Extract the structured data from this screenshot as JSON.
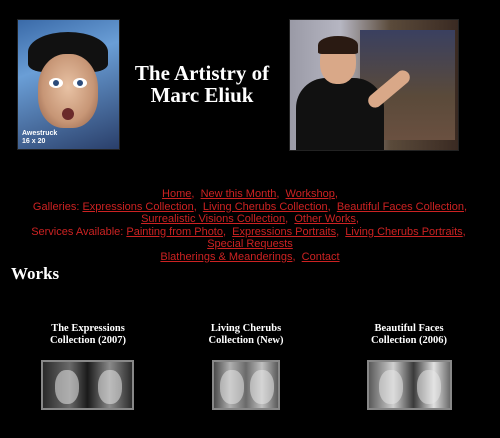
{
  "header": {
    "left_image_caption_line1": "Awestruck",
    "left_image_caption_line2": "16 x 20",
    "title_line1": "The Artistry of",
    "title_line2": "Marc Eliuk"
  },
  "nav": {
    "line1": [
      "Home",
      "New this Month",
      "Workshop"
    ],
    "galleries_label": "Galleries:",
    "galleries_line1": [
      "Expressions Collection",
      "Living Cherubs Collection",
      "Beautiful Faces Collection"
    ],
    "galleries_line2": [
      "Surrealistic Visions Collection",
      "Other Works"
    ],
    "services_label": "Services Available:",
    "services": [
      "Painting from Photo",
      "Expressions Portraits",
      "Living Cherubs Portraits",
      "Special Requests"
    ],
    "last_line": [
      "Blatherings & Meanderings",
      "Contact"
    ]
  },
  "works": {
    "heading": "Works",
    "galleries": [
      {
        "title_line1": "The Expressions",
        "title_line2": "Collection (2007)"
      },
      {
        "title_line1": "Living Cherubs",
        "title_line2": "Collection (New)"
      },
      {
        "title_line1": "Beautiful Faces",
        "title_line2": "Collection (2006)"
      }
    ]
  },
  "colors": {
    "background": "#000000",
    "link": "#cc2222",
    "text": "#ffffff"
  }
}
